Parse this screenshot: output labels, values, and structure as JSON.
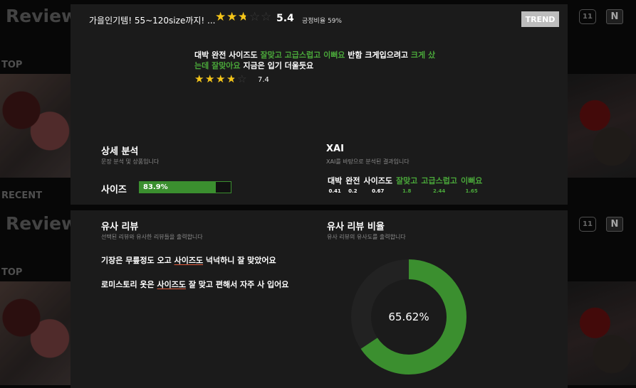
{
  "background": {
    "brand_text": "Review R",
    "section_top": "TOP",
    "section_recent": "RECENT",
    "badge_11st": "11",
    "badge_naver": "N"
  },
  "header": {
    "product_title": "가을인기템! 55~120size까지! ...",
    "rating": 5.4,
    "rating_max": 10,
    "rating_label": "5.4",
    "positive_label": "긍정비율 59%",
    "trend_button": "TREND"
  },
  "review": {
    "segments": [
      {
        "text": "대박 완전 사이즈도 ",
        "highlight": false
      },
      {
        "text": "잘맞고 고급스럽고 이뻐요",
        "highlight": true
      },
      {
        "text": " 반함 크게입으려고 ",
        "highlight": false
      },
      {
        "text": "크게 샀는데 잘맞아요",
        "highlight": true
      },
      {
        "text": " 지금은 입기 더울듯요",
        "highlight": false
      }
    ],
    "rating": 7.4,
    "rating_max": 10,
    "rating_label": "7.4"
  },
  "detail_analysis": {
    "title": "상세 분석",
    "subtitle": "문장 분석 및 상품입니다",
    "attribute": "사이즈",
    "score": 83.9,
    "score_label": "83.9%"
  },
  "xai": {
    "title": "XAI",
    "subtitle": "XAI를 바탕으로 분석된 결과입니다",
    "tokens": [
      {
        "word": "대박",
        "score": "0.41",
        "positive": false
      },
      {
        "word": "완전",
        "score": "0.2",
        "positive": false
      },
      {
        "word": "사이즈도",
        "score": "0.67",
        "positive": false
      },
      {
        "word": "잘맞고",
        "score": "1.8",
        "positive": true
      },
      {
        "word": "고급스럽고",
        "score": "2.44",
        "positive": true
      },
      {
        "word": "이뻐요",
        "score": "1.65",
        "positive": true
      }
    ]
  },
  "similar_reviews": {
    "title": "유사 리뷰",
    "subtitle": "선택된 리뷰와 유사한 리뷰들을 출력합니다",
    "items": [
      {
        "before": "기장은 무릎정도 오고 ",
        "keyword": "사이즈도",
        "after": " 넉넉하니 잘 맞았어요"
      },
      {
        "before": "로미스토리 옷은 ",
        "keyword": "사이즈도",
        "after": " 잘 맞고 편해서 자주 사 입어요"
      }
    ]
  },
  "similarity_ratio": {
    "title": "유사 리뷰 비율",
    "subtitle": "유사 리뷰의 유사도를 출력합니다",
    "value": 65.62,
    "label": "65.62%"
  },
  "colors": {
    "accent_green": "#3b8f2f",
    "highlight_green": "#4aa83a",
    "star_gold": "#f5c518",
    "trend_button": "#bdbdbd"
  }
}
